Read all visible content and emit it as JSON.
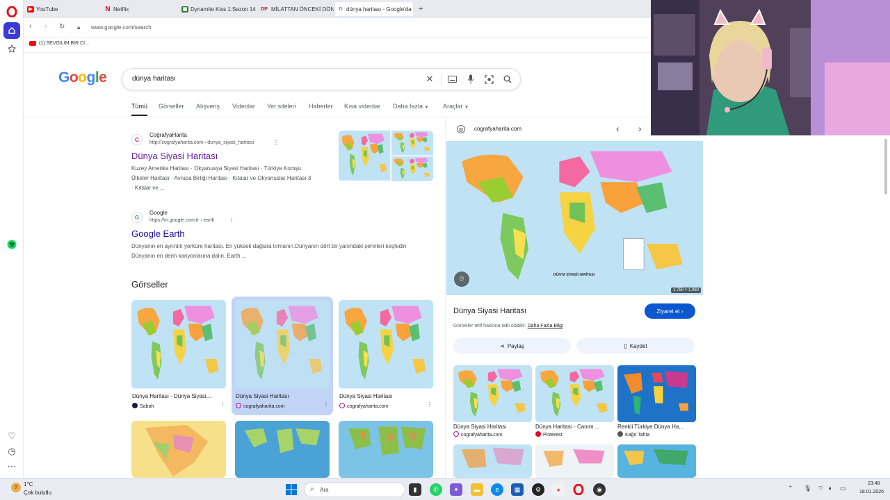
{
  "browser": {
    "tabs": [
      {
        "label": "YouTube",
        "icon": "youtube-icon"
      },
      {
        "label": "Netflix",
        "icon": "netflix-icon"
      },
      {
        "label": "Dynamite Kiss 1.Sezon 14.",
        "icon": "bookmark-icon"
      },
      {
        "label": "MİLATTAN ÖNCEKİ DÖNEM",
        "icon": "dp-icon"
      },
      {
        "label": "dünya haritası - Google'da",
        "icon": "google-icon"
      }
    ],
    "url": "www.google.com/search",
    "bookmark": "(1) SEVGİLİM BİR Cİ..."
  },
  "search": {
    "logo": "Google",
    "query": "dünya haritası",
    "tabs": [
      "Tümü",
      "Görseller",
      "Alışveriş",
      "Videolar",
      "Yer siteleri",
      "Haberler",
      "Kısa videolar",
      "Daha fazla",
      "Araçlar"
    ]
  },
  "results": [
    {
      "site": "CoğrafyaHarita",
      "url": "http://cografyaharita.com › dunya_siyasi_haritasi",
      "title": "Dünya Siyasi Haritası",
      "snippet": "Kuzey Amerika Haritası · Okyanusya Siyasi Haritası · Türkiye Komşu Ülkeler Haritası · Avrupa Birliği Haritası · Kıtalar ve Okyanuslar Haritası 3 · Kıtalar ve ..."
    },
    {
      "site": "Google",
      "url": "https://m.google.com.tr › earth",
      "title": "Google Earth",
      "snippet": "Dünyanın en ayrıntılı yerküre haritası. En yüksek dağlara tırmanın.Dünyanın dört bir yanındaki şehirleri keşfedin Dünyanın en derin kanyonlarına dalın. Earth ..."
    }
  ],
  "images": {
    "heading": "Görseller",
    "cards": [
      {
        "title": "Dünya Haritası - Dünya Siyasi...",
        "source": "Sabah"
      },
      {
        "title": "Dünya Siyasi Haritası",
        "source": "cografyaharita.com"
      },
      {
        "title": "Dünya Siyasi Haritası",
        "source": "cografyaharita.com"
      }
    ]
  },
  "panel": {
    "domain": "cografyaharita.com",
    "image_size": "1.750 × 1.060",
    "map_caption": "DÜNYA SİYASİ HARİTASI",
    "title": "Dünya Siyasi Haritası",
    "visit": "Ziyaret et",
    "note_prefix": "Görseller telif hakkına tabi olabilir.",
    "note_link": "Daha Fazla Bilgi",
    "share": "Paylaş",
    "save": "Kaydet",
    "related": [
      {
        "title": "Dünya Siyasi Haritası",
        "source": "cografyaharita.com"
      },
      {
        "title": "Dünya Haritası - Canım ...",
        "source": "Pinterest"
      },
      {
        "title": "Renkli Türkiye Dünya Ha...",
        "source": "Kağıt Tahta"
      }
    ]
  },
  "taskbar": {
    "temp": "1°C",
    "weather": "Çok bulutlu",
    "search": "Ara",
    "time": "23:48",
    "date": "18.01.2026"
  }
}
